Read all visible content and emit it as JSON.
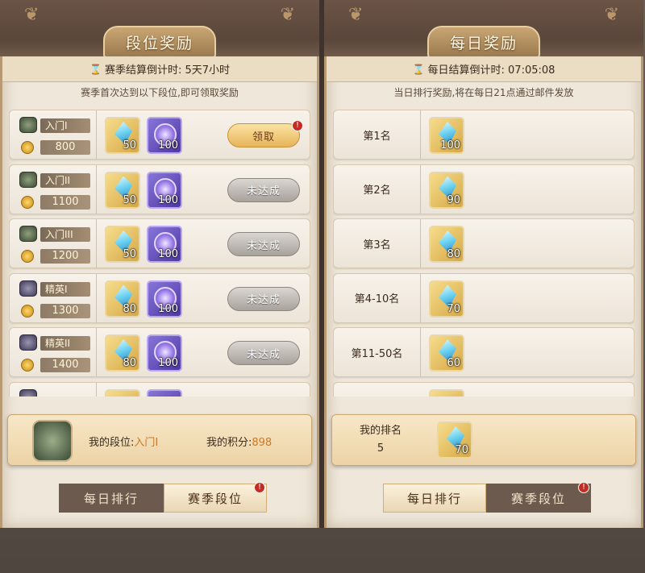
{
  "left": {
    "title": "段位奖励",
    "countdown": "赛季结算倒计时: 5天7小时",
    "subtitle": "赛季首次达到以下段位,即可领取奖励",
    "rows": [
      {
        "tier": "入门I",
        "points": "800",
        "gem": "50",
        "token": "100",
        "button": "领取"
      },
      {
        "tier": "入门II",
        "points": "1100",
        "gem": "50",
        "token": "100",
        "button": "未达成"
      },
      {
        "tier": "入门III",
        "points": "1200",
        "gem": "50",
        "token": "100",
        "button": "未达成"
      },
      {
        "tier": "精英I",
        "points": "1300",
        "gem": "80",
        "token": "100",
        "button": "未达成"
      },
      {
        "tier": "精英II",
        "points": "1400",
        "gem": "80",
        "token": "100",
        "button": "未达成"
      }
    ],
    "my_rank_label": "我的段位:",
    "my_rank_value": "入门I",
    "my_points_label": "我的积分:",
    "my_points_value": "898",
    "tabs": {
      "daily": "每日排行",
      "season": "赛季段位"
    }
  },
  "right": {
    "title": "每日奖励",
    "countdown": "每日结算倒计时: 07:05:08",
    "subtitle": "当日排行奖励,将在每日21点通过邮件发放",
    "rows": [
      {
        "place": "第1名",
        "gem": "100"
      },
      {
        "place": "第2名",
        "gem": "90"
      },
      {
        "place": "第3名",
        "gem": "80"
      },
      {
        "place": "第4-10名",
        "gem": "70"
      },
      {
        "place": "第11-50名",
        "gem": "60"
      }
    ],
    "my_place_label": "我的排名",
    "my_place_value": "5",
    "my_gem": "70",
    "tabs": {
      "daily": "每日排行",
      "season": "赛季段位"
    }
  },
  "notify_mark": "!",
  "icons": [
    "hourglass-icon",
    "rank-badge-icon",
    "coin-icon",
    "crystal-icon",
    "shield-token-icon",
    "rank-emblem-icon"
  ]
}
